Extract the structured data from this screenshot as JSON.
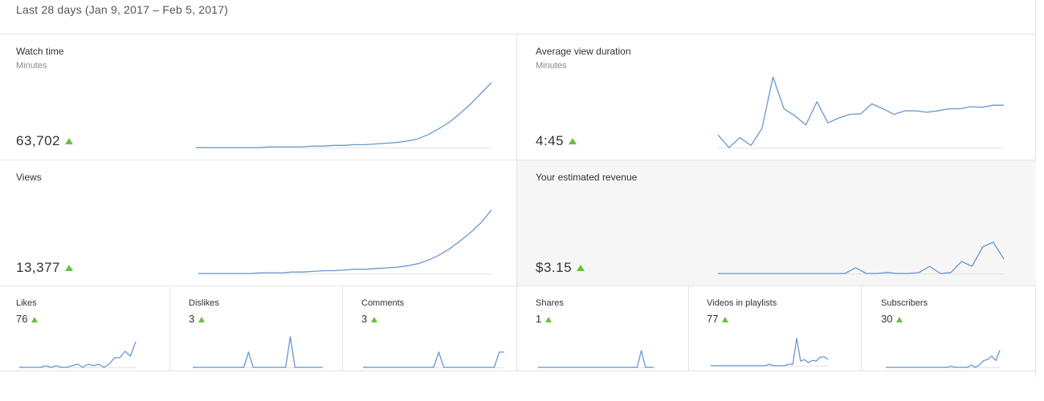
{
  "date_range": "Last 28 days (Jan 9, 2017 – Feb 5, 2017)",
  "colors": {
    "accent_line": "#6a97cf",
    "trend_up": "#6bbf3c",
    "highlight_bg": "#f6f6f6"
  },
  "cards": {
    "watch_time": {
      "title": "Watch time",
      "subtitle": "Minutes",
      "value": "63,702",
      "trend": "up",
      "series": [
        0,
        0,
        0,
        0,
        0,
        0,
        0,
        0.01,
        0.01,
        0.01,
        0.01,
        0.02,
        0.02,
        0.03,
        0.03,
        0.04,
        0.04,
        0.05,
        0.06,
        0.07,
        0.09,
        0.12,
        0.18,
        0.26,
        0.35,
        0.47,
        0.6,
        0.75,
        0.9
      ]
    },
    "avg_view_duration": {
      "title": "Average view duration",
      "subtitle": "Minutes",
      "value": "4:45",
      "trend": "up",
      "series": [
        0.18,
        0,
        0.14,
        0.03,
        0.27,
        1,
        0.55,
        0.45,
        0.32,
        0.65,
        0.35,
        0.42,
        0.47,
        0.48,
        0.62,
        0.55,
        0.47,
        0.52,
        0.52,
        0.5,
        0.52,
        0.55,
        0.55,
        0.58,
        0.57,
        0.6,
        0.6
      ]
    },
    "views": {
      "title": "Views",
      "subtitle": "",
      "value": "13,377",
      "trend": "up",
      "series": [
        0,
        0,
        0,
        0,
        0,
        0,
        0.01,
        0.01,
        0.01,
        0.02,
        0.02,
        0.03,
        0.04,
        0.04,
        0.05,
        0.06,
        0.06,
        0.07,
        0.08,
        0.09,
        0.11,
        0.14,
        0.19,
        0.26,
        0.35,
        0.46,
        0.58,
        0.72,
        0.9
      ]
    },
    "revenue": {
      "title": "Your estimated revenue",
      "subtitle": "",
      "value": "$3.15",
      "trend": "up",
      "series": [
        0,
        0,
        0,
        0,
        0,
        0,
        0,
        0,
        0,
        0,
        0,
        0,
        0,
        0.12,
        0,
        0,
        0.02,
        0,
        0,
        0.02,
        0.15,
        0,
        0.02,
        0.25,
        0.15,
        0.55,
        0.65,
        0.3
      ]
    }
  },
  "small_cards": [
    {
      "title": "Likes",
      "value": "76",
      "trend": "up",
      "series": [
        0,
        0,
        0,
        0,
        0,
        0.05,
        0,
        0.05,
        0,
        0,
        0.05,
        0.1,
        0,
        0.1,
        0.05,
        0.1,
        0,
        0.1,
        0.3,
        0.3,
        0.5,
        0.35,
        0.8
      ]
    },
    {
      "title": "Dislikes",
      "value": "3",
      "trend": "up",
      "series": [
        0,
        0,
        0,
        0,
        0,
        0,
        0,
        0,
        0,
        0,
        0,
        0,
        0.5,
        0,
        0,
        0,
        0,
        0,
        0,
        0,
        0,
        1,
        0,
        0,
        0,
        0,
        0,
        0,
        0
      ]
    },
    {
      "title": "Comments",
      "value": "3",
      "trend": "up",
      "series": [
        0,
        0,
        0,
        0,
        0,
        0,
        0,
        0,
        0,
        0,
        0,
        0,
        0,
        0,
        0,
        0.5,
        0,
        0,
        0,
        0,
        0,
        0,
        0,
        0,
        0,
        0,
        0,
        0.5,
        0.5
      ]
    },
    {
      "title": "Shares",
      "value": "1",
      "trend": "up",
      "series": [
        0,
        0,
        0,
        0,
        0,
        0,
        0,
        0,
        0,
        0,
        0,
        0,
        0,
        0,
        0,
        0,
        0,
        0,
        0,
        0,
        0,
        0,
        0,
        0,
        0,
        0.55,
        0,
        0,
        0
      ]
    },
    {
      "title": "Videos in playlists",
      "value": "77",
      "trend": "up",
      "series": [
        0,
        0,
        0,
        0,
        0,
        0,
        0,
        0,
        0,
        0,
        0,
        0,
        0,
        0,
        0,
        0.05,
        0,
        0,
        0,
        0,
        0.05,
        0.05,
        0.9,
        0.15,
        0.2,
        0.1,
        0.18,
        0.15,
        0.28,
        0.3,
        0.2
      ]
    },
    {
      "title": "Subscribers",
      "value": "30",
      "trend": "up",
      "series": [
        0,
        0,
        0,
        0,
        0,
        0,
        0,
        0,
        0,
        0,
        0,
        0,
        0,
        0,
        0,
        0,
        0.05,
        0,
        0,
        0,
        0,
        0.1,
        0,
        0.1,
        0.3,
        0.35,
        0.5,
        0.3,
        0.75
      ]
    }
  ]
}
